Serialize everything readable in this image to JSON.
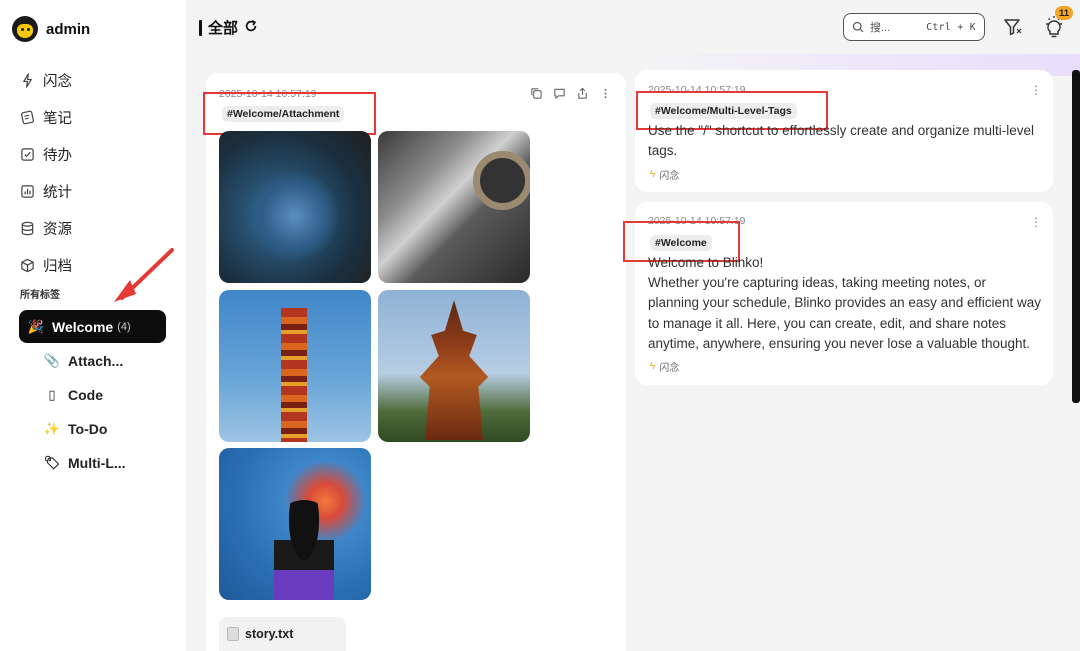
{
  "user": {
    "name": "admin"
  },
  "nav": [
    {
      "label": "闪念",
      "icon": "lightning-icon"
    },
    {
      "label": "笔记",
      "icon": "note-icon"
    },
    {
      "label": "待办",
      "icon": "checklist-icon"
    },
    {
      "label": "统计",
      "icon": "chart-icon"
    },
    {
      "label": "资源",
      "icon": "database-icon"
    },
    {
      "label": "归档",
      "icon": "archive-box-icon"
    }
  ],
  "tags": {
    "heading": "所有标签",
    "active": {
      "label": "Welcome",
      "count": "(4)",
      "emoji": "🎉"
    },
    "children": [
      {
        "label": "Attach...",
        "emoji": "📎"
      },
      {
        "label": "Code",
        "emoji": "▯"
      },
      {
        "label": "To-Do",
        "emoji": "✨"
      },
      {
        "label": "Multi-L...",
        "emoji": "🏷"
      }
    ]
  },
  "header": {
    "title": "全部",
    "refresh_icon": "refresh-icon"
  },
  "search": {
    "placeholder": "搜...",
    "shortcut": "Ctrl + K"
  },
  "notifications": {
    "count": "11"
  },
  "colors": {
    "accent_badge": "#f5a623",
    "annotation_red": "#e53935",
    "active_tag_bg": "#0d0d0d"
  },
  "notes": {
    "left": {
      "timestamp": "2025-10-14 10:57:19",
      "tag": "#Welcome/Attachment",
      "attachment": "story.txt"
    },
    "right1": {
      "timestamp": "2025-10-14 10:57:19",
      "tag": "#Welcome/Multi-Level-Tags",
      "line1": "Use the \"/\" shortcut to effortlessly create and organize multi-level",
      "line2": "tags.",
      "footer": "闪念"
    },
    "right2": {
      "timestamp": "2025-10-14 10:57:19",
      "tag": "#Welcome",
      "line1": "Welcome to Blinko!",
      "line2": "Whether you're capturing ideas, taking meeting notes, or",
      "line3": "planning your schedule, Blinko provides an easy and efficient way",
      "line4": "to manage it all. Here, you can create, edit, and share notes",
      "line5": "anytime, anywhere, ensuring you never lose a valuable thought.",
      "footer": "闪念"
    }
  }
}
